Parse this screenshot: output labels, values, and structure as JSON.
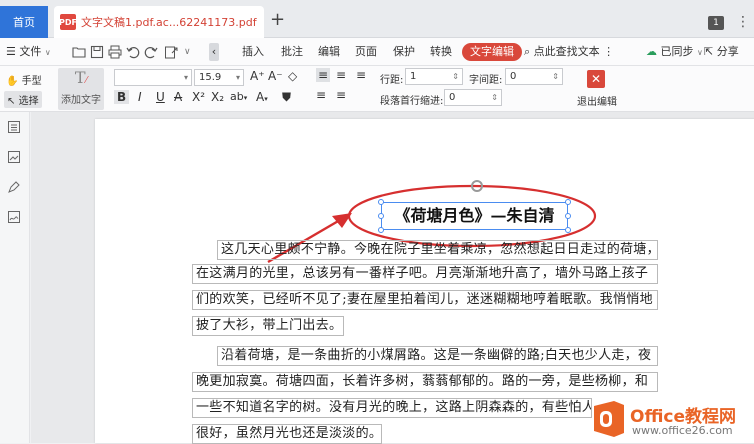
{
  "tabs": {
    "home_label": "首页",
    "doc_label": "文字文稿1.pdf.ac...62241173.pdf",
    "page_count": "1"
  },
  "menu": {
    "file_label": "文件",
    "items": [
      "插入",
      "批注",
      "编辑",
      "页面",
      "保护",
      "转换",
      "文字编辑"
    ],
    "search_label": "点此查找文本",
    "sync_label": "已同步",
    "share_label": "分享"
  },
  "ribbon": {
    "hand_label": "手型",
    "select_label": "选择",
    "add_text_label": "添加文字",
    "font_size": "15.9",
    "line_spacing_label": "行距:",
    "line_spacing_value": "1",
    "char_spacing_label": "字间距:",
    "char_spacing_value": "0",
    "indent_label": "段落首行缩进:",
    "indent_value": "0",
    "exit_label": "退出编辑"
  },
  "document": {
    "title": "《荷塘月色》—朱自清",
    "p1": [
      "这几天心里颇不宁静。今晚在院子里坐着乘凉，忽然想起日日走过的荷塘，",
      "在这满月的光里，总该另有一番样子吧。月亮渐渐地升高了，墙外马路上孩子",
      "们的欢笑，已经听不见了;妻在屋里拍着闰儿，迷迷糊糊地哼着眠歌。我悄悄地",
      "披了大衫，带上门出去。"
    ],
    "p2": [
      "沿着荷塘，是一条曲折的小煤屑路。这是一条幽僻的路;白天也少人走，夜",
      "晚更加寂寞。荷塘四面，长着许多树，蓊蓊郁郁的。路的一旁，是些杨柳，和",
      "一些不知道名字的树。没有月光的晚上，这路上阴森森的，有些怕人。今晚",
      "很好，虽然月光也还是淡淡的。"
    ]
  },
  "watermark": {
    "brand": "Office教程网",
    "url": "www.office26.com"
  },
  "colors": {
    "accent_blue": "#2f74d9",
    "edit_red": "#d9483b",
    "annotation_red": "#d62f2f"
  }
}
